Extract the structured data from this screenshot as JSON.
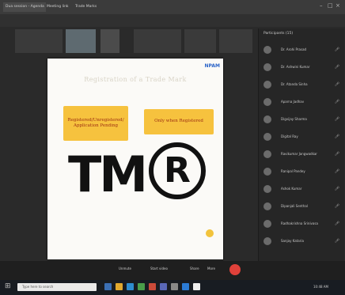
{
  "browser": {
    "tabs": [
      "Dua session - Agenda",
      "Meeting link",
      "Trade Marks"
    ]
  },
  "slide": {
    "logo": "NPAM",
    "title": "Registration of a Trade Mark",
    "box_left": "Registered/Unregistered/ Application Pending",
    "box_right": "Only when Registered",
    "symbol_tm": "TM",
    "symbol_r": "R"
  },
  "participants": {
    "heading": "Participants",
    "count": "(15)",
    "items": [
      "Dr. Arohi Prasad",
      "Dr. Ashwini Kumar",
      "Dr. Atanda Sinha",
      "Aparna Jadhav",
      "Digvijay Sharma",
      "Digital Ray",
      "Ravikumar Jangwadkar",
      "Ranipal Pandey",
      "Ashok Kumar",
      "Dipanjali Senthal",
      "Radhakrishna Srinivasa",
      "Sanjay Kataria"
    ]
  },
  "controls": {
    "mic_label": "Unmute",
    "video_label": "Start video",
    "share_label": "Share",
    "more_label": "More"
  },
  "taskbar": {
    "search_placeholder": "Type here to search",
    "time": "10:48 AM"
  },
  "colors": {
    "accent_yellow": "#f6c23e",
    "box_text": "#9c2d12",
    "end_call": "#e0413a"
  }
}
